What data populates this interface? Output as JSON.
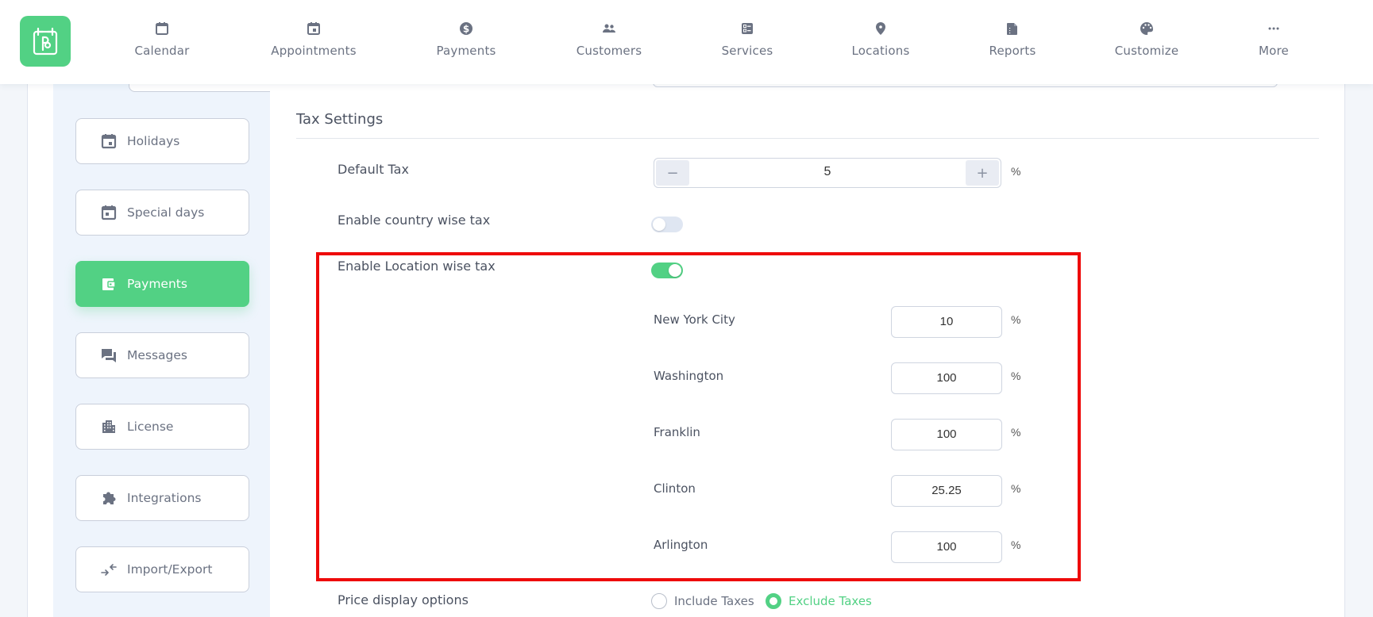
{
  "header": {
    "logo_name": "app-logo",
    "nav": [
      {
        "label": "Calendar",
        "icon": "calendar-icon"
      },
      {
        "label": "Appointments",
        "icon": "calendar-event-icon"
      },
      {
        "label": "Payments",
        "icon": "dollar-circle-icon"
      },
      {
        "label": "Customers",
        "icon": "users-icon"
      },
      {
        "label": "Services",
        "icon": "services-icon"
      },
      {
        "label": "Locations",
        "icon": "location-pin-icon"
      },
      {
        "label": "Reports",
        "icon": "report-icon"
      },
      {
        "label": "Customize",
        "icon": "palette-icon"
      },
      {
        "label": "More",
        "icon": "more-dots-icon"
      }
    ]
  },
  "sidebar": {
    "items": [
      {
        "label": "Holidays",
        "icon": "calendar-icon",
        "active": false
      },
      {
        "label": "Special days",
        "icon": "calendar-icon",
        "active": false
      },
      {
        "label": "Payments",
        "icon": "wallet-icon",
        "active": true
      },
      {
        "label": "Messages",
        "icon": "chat-icon",
        "active": false
      },
      {
        "label": "License",
        "icon": "building-icon",
        "active": false
      },
      {
        "label": "Integrations",
        "icon": "puzzle-icon",
        "active": false
      },
      {
        "label": "Import/Export",
        "icon": "import-export-icon",
        "active": false
      }
    ]
  },
  "tax_settings": {
    "title": "Tax Settings",
    "default_tax": {
      "label": "Default Tax",
      "value": "5",
      "unit": "%",
      "decrement": "−",
      "increment": "+"
    },
    "country_wise": {
      "label": "Enable country wise tax",
      "enabled": false
    },
    "location_wise": {
      "label": "Enable Location wise tax",
      "enabled": true
    },
    "locations": [
      {
        "name": "New York City",
        "value": "10",
        "unit": "%"
      },
      {
        "name": "Washington",
        "value": "100",
        "unit": "%"
      },
      {
        "name": "Franklin",
        "value": "100",
        "unit": "%"
      },
      {
        "name": "Clinton",
        "value": "25.25",
        "unit": "%"
      },
      {
        "name": "Arlington",
        "value": "100",
        "unit": "%"
      }
    ],
    "price_display": {
      "label": "Price display options",
      "options": [
        {
          "label": "Include Taxes",
          "selected": false
        },
        {
          "label": "Exclude Taxes",
          "selected": true
        }
      ]
    }
  },
  "colors": {
    "accent": "#52d184",
    "highlight": "#ee0a0a",
    "text": "#4b5261",
    "muted": "#6b7282"
  }
}
